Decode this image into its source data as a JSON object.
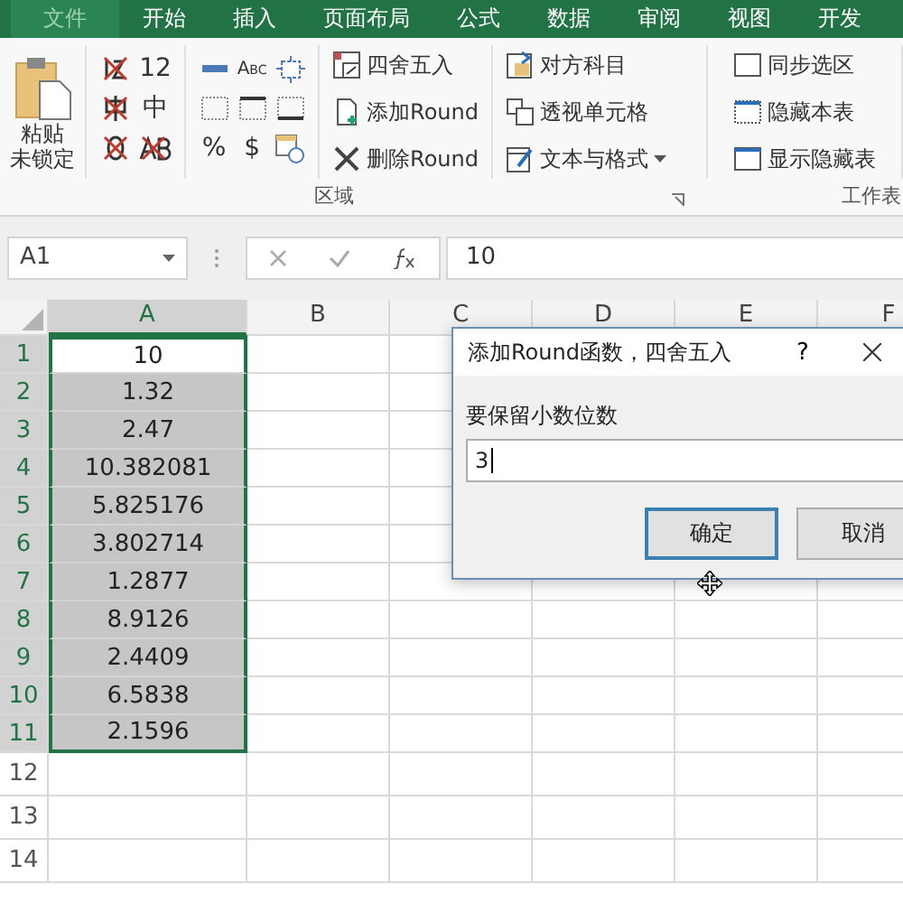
{
  "tabs": [
    {
      "label": "文件",
      "kind": "file"
    },
    {
      "label": "开始",
      "kind": "tab"
    },
    {
      "label": "插入",
      "kind": "tab"
    },
    {
      "label": "页面布局",
      "kind": "tab"
    },
    {
      "label": "公式",
      "kind": "tab"
    },
    {
      "label": "数据",
      "kind": "tab"
    },
    {
      "label": "审阅",
      "kind": "tab"
    },
    {
      "label": "视图",
      "kind": "tab"
    },
    {
      "label": "开发",
      "kind": "tab"
    }
  ],
  "ribbon": {
    "paste": {
      "label": "粘贴",
      "sublabel": "未锁定"
    },
    "format_texts": {
      "digits": "12",
      "chinese": "中",
      "abc": "Abc",
      "percent": "%",
      "dollar": "$"
    },
    "round_buttons": [
      {
        "label": "四舍五入",
        "kind": "round"
      },
      {
        "label": "添加Round",
        "kind": "add"
      },
      {
        "label": "删除Round",
        "kind": "delete"
      }
    ],
    "tools": [
      {
        "label": "对方科目",
        "kind": "match",
        "menu": false
      },
      {
        "label": "透视单元格",
        "kind": "pivot",
        "menu": false
      },
      {
        "label": "文本与格式",
        "kind": "text",
        "menu": true
      }
    ],
    "group_label": "区域",
    "sheet_buttons": [
      {
        "label": "同步选区",
        "kind": "sync"
      },
      {
        "label": "隐藏本表",
        "kind": "hide"
      },
      {
        "label": "显示隐藏表",
        "kind": "show"
      }
    ],
    "sheet_group_label": "工作表"
  },
  "name_box": "A1",
  "formula": "10",
  "columns": [
    {
      "label": "A",
      "selected": true
    },
    {
      "label": "B",
      "selected": false
    },
    {
      "label": "C",
      "selected": false
    },
    {
      "label": "D",
      "selected": false
    },
    {
      "label": "E",
      "selected": false
    },
    {
      "label": "F",
      "selected": false
    }
  ],
  "rows": [
    {
      "number": "1",
      "a": "10",
      "selected": true,
      "active": true
    },
    {
      "number": "2",
      "a": "1.32",
      "selected": true,
      "active": false
    },
    {
      "number": "3",
      "a": "2.47",
      "selected": true,
      "active": false
    },
    {
      "number": "4",
      "a": "10.382081",
      "selected": true,
      "active": false
    },
    {
      "number": "5",
      "a": "5.825176",
      "selected": true,
      "active": false
    },
    {
      "number": "6",
      "a": "3.802714",
      "selected": true,
      "active": false
    },
    {
      "number": "7",
      "a": "1.2877",
      "selected": true,
      "active": false
    },
    {
      "number": "8",
      "a": "8.9126",
      "selected": true,
      "active": false
    },
    {
      "number": "9",
      "a": "2.4409",
      "selected": true,
      "active": false
    },
    {
      "number": "10",
      "a": "6.5838",
      "selected": true,
      "active": false
    },
    {
      "number": "11",
      "a": "2.1596",
      "selected": true,
      "active": false
    },
    {
      "number": "12",
      "selected": false
    },
    {
      "number": "13",
      "selected": false
    },
    {
      "number": "14",
      "selected": false
    }
  ],
  "dialog": {
    "title": "添加Round函数，四舍五入",
    "help": "?",
    "label": "要保留小数位数",
    "value": "3",
    "buttons": [
      {
        "label": "确定",
        "default": true
      },
      {
        "label": "取消",
        "default": false
      }
    ]
  }
}
